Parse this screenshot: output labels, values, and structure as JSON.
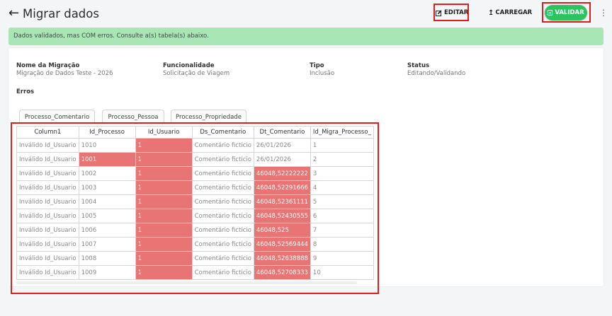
{
  "header": {
    "back_icon": "arrow-left-icon",
    "title": "Migrar dados",
    "edit_label": "EDITAR",
    "load_label": "CARREGAR",
    "validate_label": "VALIDAR",
    "menu_icon": "kebab-icon"
  },
  "alert": {
    "message": "Dados validados, mas COM erros. Consulte a(s) tabela(s) abaixo."
  },
  "info": {
    "migration_label": "Nome da Migração",
    "migration_value": "Migração de Dados Teste - 2026",
    "feature_label": "Funcionalidade",
    "feature_value": "Solicitação de Viagem",
    "type_label": "Tipo",
    "type_value": "Inclusão",
    "status_label": "Status",
    "status_value": "Editando/Validando"
  },
  "errors_label": "Erros",
  "tabs": [
    "Processo_Comentario",
    "Processo_Pessoa",
    "Processo_Propriedade"
  ],
  "table": {
    "columns": [
      "Column1",
      "Id_Processo",
      "Id_Usuario",
      "Ds_Comentario",
      "Dt_Comentario",
      "Id_Migra_Processo_"
    ],
    "rows": [
      [
        "Inválido Id_Usuario",
        "1010",
        "1",
        "Comentário fictício",
        "26/01/2026",
        "1"
      ],
      [
        "Inválido Id_Usuario",
        "1001",
        "1",
        "Comentário fictício",
        "26/01/2026",
        "2"
      ],
      [
        "Inválido Id_Usuario",
        "1002",
        "1",
        "Comentário fictício",
        "46048,52222222",
        "3"
      ],
      [
        "Inválido Id_Usuario",
        "1003",
        "1",
        "Comentário fictício",
        "46048,52291666",
        "4"
      ],
      [
        "Inválido Id_Usuario",
        "1004",
        "1",
        "Comentário fictício",
        "46048,52361111",
        "5"
      ],
      [
        "Inválido Id_Usuario",
        "1005",
        "1",
        "Comentário fictício",
        "46048,52430555",
        "6"
      ],
      [
        "Inválido Id_Usuario",
        "1006",
        "1",
        "Comentário fictício",
        "46048,525",
        "7"
      ],
      [
        "Inválido Id_Usuario",
        "1007",
        "1",
        "Comentário fictício",
        "46048,52569444",
        "8"
      ],
      [
        "Inválido Id_Usuario",
        "1008",
        "1",
        "Comentário fictício",
        "46048,52638888",
        "9"
      ],
      [
        "Inválido Id_Usuario",
        "1009",
        "1",
        "Comentário fictício",
        "46048,52708333",
        "10"
      ]
    ],
    "error_cells": [
      [
        0,
        2
      ],
      [
        1,
        1
      ],
      [
        1,
        2
      ],
      [
        2,
        2
      ],
      [
        2,
        4
      ],
      [
        3,
        2
      ],
      [
        3,
        4
      ],
      [
        4,
        2
      ],
      [
        4,
        4
      ],
      [
        5,
        2
      ],
      [
        5,
        4
      ],
      [
        6,
        2
      ],
      [
        6,
        4
      ],
      [
        7,
        2
      ],
      [
        7,
        4
      ],
      [
        8,
        2
      ],
      [
        8,
        4
      ],
      [
        9,
        2
      ],
      [
        9,
        4
      ]
    ]
  },
  "colors": {
    "accent_green": "#2bc461",
    "alert_green": "#a8e6b6",
    "error_red": "#e87474",
    "highlight_red": "#e01c1c"
  }
}
